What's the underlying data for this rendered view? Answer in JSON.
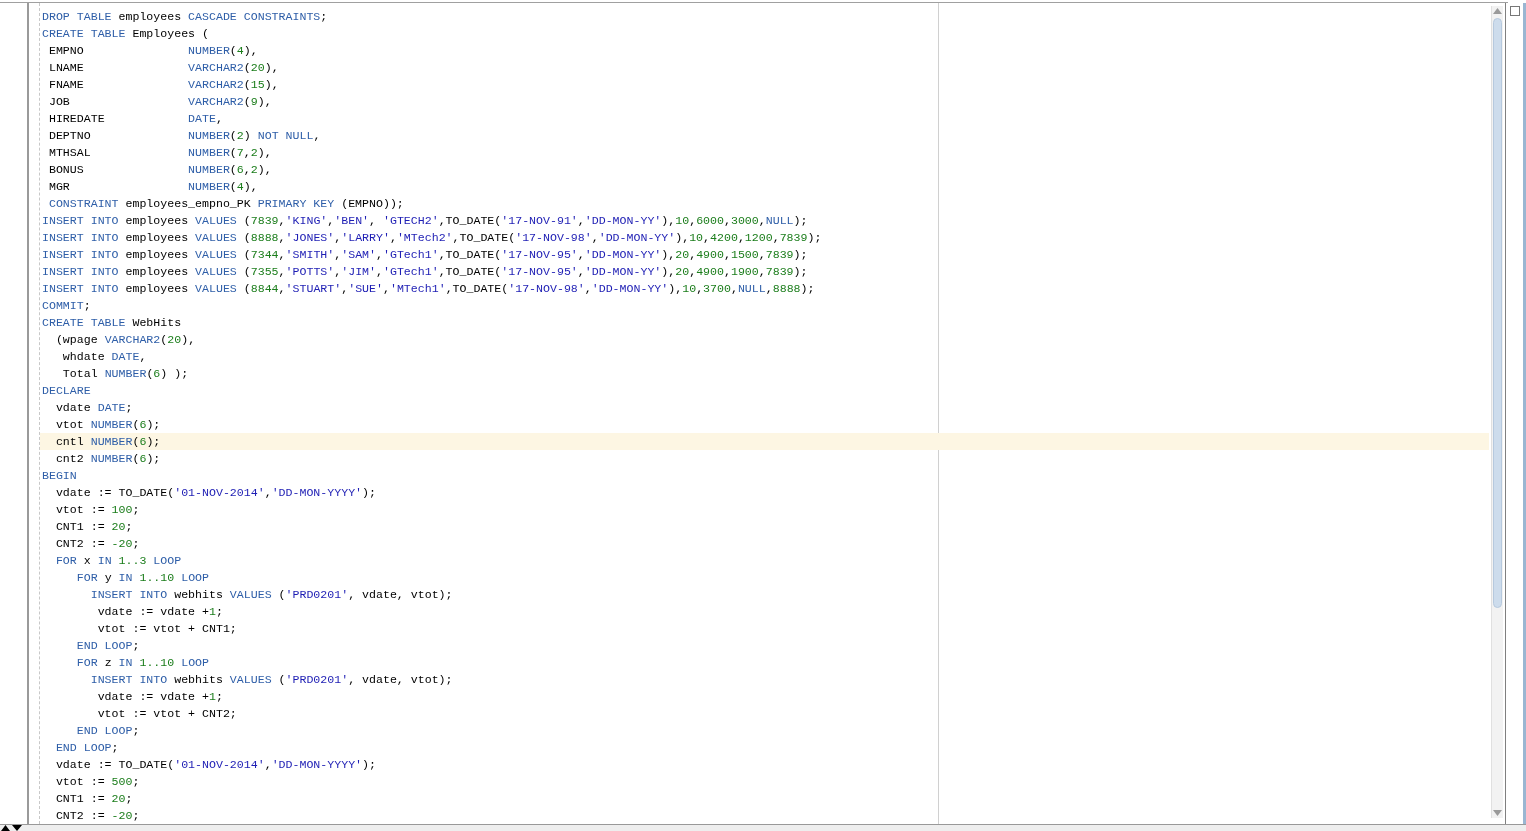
{
  "editor": {
    "lines": [
      {
        "current": false,
        "tokens": [
          {
            "kind": "kw",
            "text": "DROP TABLE"
          },
          {
            "kind": "plain",
            "text": " employees "
          },
          {
            "kind": "kw",
            "text": "CASCADE CONSTRAINTS"
          },
          {
            "kind": "plain",
            "text": ";"
          }
        ]
      },
      {
        "current": false,
        "tokens": [
          {
            "kind": "kw",
            "text": "CREATE TABLE"
          },
          {
            "kind": "plain",
            "text": " Employees ("
          }
        ]
      },
      {
        "current": false,
        "tokens": [
          {
            "kind": "plain",
            "text": " EMPNO               "
          },
          {
            "kind": "kw",
            "text": "NUMBER"
          },
          {
            "kind": "plain",
            "text": "("
          },
          {
            "kind": "num",
            "text": "4"
          },
          {
            "kind": "plain",
            "text": "),"
          }
        ]
      },
      {
        "current": false,
        "tokens": [
          {
            "kind": "plain",
            "text": " LNAME               "
          },
          {
            "kind": "kw",
            "text": "VARCHAR2"
          },
          {
            "kind": "plain",
            "text": "("
          },
          {
            "kind": "num",
            "text": "20"
          },
          {
            "kind": "plain",
            "text": "),"
          }
        ]
      },
      {
        "current": false,
        "tokens": [
          {
            "kind": "plain",
            "text": " FNAME               "
          },
          {
            "kind": "kw",
            "text": "VARCHAR2"
          },
          {
            "kind": "plain",
            "text": "("
          },
          {
            "kind": "num",
            "text": "15"
          },
          {
            "kind": "plain",
            "text": "),"
          }
        ]
      },
      {
        "current": false,
        "tokens": [
          {
            "kind": "plain",
            "text": " JOB                 "
          },
          {
            "kind": "kw",
            "text": "VARCHAR2"
          },
          {
            "kind": "plain",
            "text": "("
          },
          {
            "kind": "num",
            "text": "9"
          },
          {
            "kind": "plain",
            "text": "),"
          }
        ]
      },
      {
        "current": false,
        "tokens": [
          {
            "kind": "plain",
            "text": " HIREDATE            "
          },
          {
            "kind": "kw",
            "text": "DATE"
          },
          {
            "kind": "plain",
            "text": ","
          }
        ]
      },
      {
        "current": false,
        "tokens": [
          {
            "kind": "plain",
            "text": " DEPTNO              "
          },
          {
            "kind": "kw",
            "text": "NUMBER"
          },
          {
            "kind": "plain",
            "text": "("
          },
          {
            "kind": "num",
            "text": "2"
          },
          {
            "kind": "plain",
            "text": ") "
          },
          {
            "kind": "kw",
            "text": "NOT NULL"
          },
          {
            "kind": "plain",
            "text": ","
          }
        ]
      },
      {
        "current": false,
        "tokens": [
          {
            "kind": "plain",
            "text": " MTHSAL              "
          },
          {
            "kind": "kw",
            "text": "NUMBER"
          },
          {
            "kind": "plain",
            "text": "("
          },
          {
            "kind": "num",
            "text": "7"
          },
          {
            "kind": "plain",
            "text": ","
          },
          {
            "kind": "num",
            "text": "2"
          },
          {
            "kind": "plain",
            "text": "),"
          }
        ]
      },
      {
        "current": false,
        "tokens": [
          {
            "kind": "plain",
            "text": " BONUS               "
          },
          {
            "kind": "kw",
            "text": "NUMBER"
          },
          {
            "kind": "plain",
            "text": "("
          },
          {
            "kind": "num",
            "text": "6"
          },
          {
            "kind": "plain",
            "text": ","
          },
          {
            "kind": "num",
            "text": "2"
          },
          {
            "kind": "plain",
            "text": "),"
          }
        ]
      },
      {
        "current": false,
        "tokens": [
          {
            "kind": "plain",
            "text": " MGR                 "
          },
          {
            "kind": "kw",
            "text": "NUMBER"
          },
          {
            "kind": "plain",
            "text": "("
          },
          {
            "kind": "num",
            "text": "4"
          },
          {
            "kind": "plain",
            "text": "),"
          }
        ]
      },
      {
        "current": false,
        "tokens": [
          {
            "kind": "kw",
            "text": " CONSTRAINT"
          },
          {
            "kind": "plain",
            "text": " employees_empno_PK "
          },
          {
            "kind": "kw",
            "text": "PRIMARY KEY"
          },
          {
            "kind": "plain",
            "text": " (EMPNO));"
          }
        ]
      },
      {
        "current": false,
        "tokens": [
          {
            "kind": "kw",
            "text": "INSERT INTO"
          },
          {
            "kind": "plain",
            "text": " employees "
          },
          {
            "kind": "kw",
            "text": "VALUES"
          },
          {
            "kind": "plain",
            "text": " ("
          },
          {
            "kind": "num",
            "text": "7839"
          },
          {
            "kind": "plain",
            "text": ","
          },
          {
            "kind": "str",
            "text": "'KING'"
          },
          {
            "kind": "plain",
            "text": ","
          },
          {
            "kind": "str",
            "text": "'BEN'"
          },
          {
            "kind": "plain",
            "text": ", "
          },
          {
            "kind": "str",
            "text": "'GTECH2'"
          },
          {
            "kind": "plain",
            "text": ",TO_DATE("
          },
          {
            "kind": "str",
            "text": "'17-NOV-91'"
          },
          {
            "kind": "plain",
            "text": ","
          },
          {
            "kind": "str",
            "text": "'DD-MON-YY'"
          },
          {
            "kind": "plain",
            "text": "),"
          },
          {
            "kind": "num",
            "text": "10"
          },
          {
            "kind": "plain",
            "text": ","
          },
          {
            "kind": "num",
            "text": "6000"
          },
          {
            "kind": "plain",
            "text": ","
          },
          {
            "kind": "num",
            "text": "3000"
          },
          {
            "kind": "plain",
            "text": ","
          },
          {
            "kind": "kw",
            "text": "NULL"
          },
          {
            "kind": "plain",
            "text": ");"
          }
        ]
      },
      {
        "current": false,
        "tokens": [
          {
            "kind": "kw",
            "text": "INSERT INTO"
          },
          {
            "kind": "plain",
            "text": " employees "
          },
          {
            "kind": "kw",
            "text": "VALUES"
          },
          {
            "kind": "plain",
            "text": " ("
          },
          {
            "kind": "num",
            "text": "8888"
          },
          {
            "kind": "plain",
            "text": ","
          },
          {
            "kind": "str",
            "text": "'JONES'"
          },
          {
            "kind": "plain",
            "text": ","
          },
          {
            "kind": "str",
            "text": "'LARRY'"
          },
          {
            "kind": "plain",
            "text": ","
          },
          {
            "kind": "str",
            "text": "'MTech2'"
          },
          {
            "kind": "plain",
            "text": ",TO_DATE("
          },
          {
            "kind": "str",
            "text": "'17-NOV-98'"
          },
          {
            "kind": "plain",
            "text": ","
          },
          {
            "kind": "str",
            "text": "'DD-MON-YY'"
          },
          {
            "kind": "plain",
            "text": "),"
          },
          {
            "kind": "num",
            "text": "10"
          },
          {
            "kind": "plain",
            "text": ","
          },
          {
            "kind": "num",
            "text": "4200"
          },
          {
            "kind": "plain",
            "text": ","
          },
          {
            "kind": "num",
            "text": "1200"
          },
          {
            "kind": "plain",
            "text": ","
          },
          {
            "kind": "num",
            "text": "7839"
          },
          {
            "kind": "plain",
            "text": ");"
          }
        ]
      },
      {
        "current": false,
        "tokens": [
          {
            "kind": "kw",
            "text": "INSERT INTO"
          },
          {
            "kind": "plain",
            "text": " employees "
          },
          {
            "kind": "kw",
            "text": "VALUES"
          },
          {
            "kind": "plain",
            "text": " ("
          },
          {
            "kind": "num",
            "text": "7344"
          },
          {
            "kind": "plain",
            "text": ","
          },
          {
            "kind": "str",
            "text": "'SMITH'"
          },
          {
            "kind": "plain",
            "text": ","
          },
          {
            "kind": "str",
            "text": "'SAM'"
          },
          {
            "kind": "plain",
            "text": ","
          },
          {
            "kind": "str",
            "text": "'GTech1'"
          },
          {
            "kind": "plain",
            "text": ",TO_DATE("
          },
          {
            "kind": "str",
            "text": "'17-NOV-95'"
          },
          {
            "kind": "plain",
            "text": ","
          },
          {
            "kind": "str",
            "text": "'DD-MON-YY'"
          },
          {
            "kind": "plain",
            "text": "),"
          },
          {
            "kind": "num",
            "text": "20"
          },
          {
            "kind": "plain",
            "text": ","
          },
          {
            "kind": "num",
            "text": "4900"
          },
          {
            "kind": "plain",
            "text": ","
          },
          {
            "kind": "num",
            "text": "1500"
          },
          {
            "kind": "plain",
            "text": ","
          },
          {
            "kind": "num",
            "text": "7839"
          },
          {
            "kind": "plain",
            "text": ");"
          }
        ]
      },
      {
        "current": false,
        "tokens": [
          {
            "kind": "kw",
            "text": "INSERT INTO"
          },
          {
            "kind": "plain",
            "text": " employees "
          },
          {
            "kind": "kw",
            "text": "VALUES"
          },
          {
            "kind": "plain",
            "text": " ("
          },
          {
            "kind": "num",
            "text": "7355"
          },
          {
            "kind": "plain",
            "text": ","
          },
          {
            "kind": "str",
            "text": "'POTTS'"
          },
          {
            "kind": "plain",
            "text": ","
          },
          {
            "kind": "str",
            "text": "'JIM'"
          },
          {
            "kind": "plain",
            "text": ","
          },
          {
            "kind": "str",
            "text": "'GTech1'"
          },
          {
            "kind": "plain",
            "text": ",TO_DATE("
          },
          {
            "kind": "str",
            "text": "'17-NOV-95'"
          },
          {
            "kind": "plain",
            "text": ","
          },
          {
            "kind": "str",
            "text": "'DD-MON-YY'"
          },
          {
            "kind": "plain",
            "text": "),"
          },
          {
            "kind": "num",
            "text": "20"
          },
          {
            "kind": "plain",
            "text": ","
          },
          {
            "kind": "num",
            "text": "4900"
          },
          {
            "kind": "plain",
            "text": ","
          },
          {
            "kind": "num",
            "text": "1900"
          },
          {
            "kind": "plain",
            "text": ","
          },
          {
            "kind": "num",
            "text": "7839"
          },
          {
            "kind": "plain",
            "text": ");"
          }
        ]
      },
      {
        "current": false,
        "tokens": [
          {
            "kind": "kw",
            "text": "INSERT INTO"
          },
          {
            "kind": "plain",
            "text": " employees "
          },
          {
            "kind": "kw",
            "text": "VALUES"
          },
          {
            "kind": "plain",
            "text": " ("
          },
          {
            "kind": "num",
            "text": "8844"
          },
          {
            "kind": "plain",
            "text": ","
          },
          {
            "kind": "str",
            "text": "'STUART'"
          },
          {
            "kind": "plain",
            "text": ","
          },
          {
            "kind": "str",
            "text": "'SUE'"
          },
          {
            "kind": "plain",
            "text": ","
          },
          {
            "kind": "str",
            "text": "'MTech1'"
          },
          {
            "kind": "plain",
            "text": ",TO_DATE("
          },
          {
            "kind": "str",
            "text": "'17-NOV-98'"
          },
          {
            "kind": "plain",
            "text": ","
          },
          {
            "kind": "str",
            "text": "'DD-MON-YY'"
          },
          {
            "kind": "plain",
            "text": "),"
          },
          {
            "kind": "num",
            "text": "10"
          },
          {
            "kind": "plain",
            "text": ","
          },
          {
            "kind": "num",
            "text": "3700"
          },
          {
            "kind": "plain",
            "text": ","
          },
          {
            "kind": "kw",
            "text": "NULL"
          },
          {
            "kind": "plain",
            "text": ","
          },
          {
            "kind": "num",
            "text": "8888"
          },
          {
            "kind": "plain",
            "text": ");"
          }
        ]
      },
      {
        "current": false,
        "tokens": [
          {
            "kind": "kw",
            "text": "COMMIT"
          },
          {
            "kind": "plain",
            "text": ";"
          }
        ]
      },
      {
        "current": false,
        "tokens": [
          {
            "kind": "kw",
            "text": "CREATE TABLE"
          },
          {
            "kind": "plain",
            "text": " WebHits"
          }
        ]
      },
      {
        "current": false,
        "tokens": [
          {
            "kind": "plain",
            "text": "  (wpage "
          },
          {
            "kind": "kw",
            "text": "VARCHAR2"
          },
          {
            "kind": "plain",
            "text": "("
          },
          {
            "kind": "num",
            "text": "20"
          },
          {
            "kind": "plain",
            "text": "),"
          }
        ]
      },
      {
        "current": false,
        "tokens": [
          {
            "kind": "plain",
            "text": "   whdate "
          },
          {
            "kind": "kw",
            "text": "DATE"
          },
          {
            "kind": "plain",
            "text": ","
          }
        ]
      },
      {
        "current": false,
        "tokens": [
          {
            "kind": "plain",
            "text": "   Total "
          },
          {
            "kind": "kw",
            "text": "NUMBER"
          },
          {
            "kind": "plain",
            "text": "("
          },
          {
            "kind": "num",
            "text": "6"
          },
          {
            "kind": "plain",
            "text": ") );"
          }
        ]
      },
      {
        "current": false,
        "tokens": [
          {
            "kind": "kw",
            "text": "DECLARE"
          }
        ]
      },
      {
        "current": false,
        "tokens": [
          {
            "kind": "plain",
            "text": "  vdate "
          },
          {
            "kind": "kw",
            "text": "DATE"
          },
          {
            "kind": "plain",
            "text": ";"
          }
        ]
      },
      {
        "current": false,
        "tokens": [
          {
            "kind": "plain",
            "text": "  vtot "
          },
          {
            "kind": "kw",
            "text": "NUMBER"
          },
          {
            "kind": "plain",
            "text": "("
          },
          {
            "kind": "num",
            "text": "6"
          },
          {
            "kind": "plain",
            "text": ");"
          }
        ]
      },
      {
        "current": true,
        "tokens": [
          {
            "kind": "plain",
            "text": "  cntl "
          },
          {
            "kind": "kw",
            "text": "NUMBER"
          },
          {
            "kind": "plain",
            "text": "("
          },
          {
            "kind": "num",
            "text": "6"
          },
          {
            "kind": "plain",
            "text": ");"
          }
        ]
      },
      {
        "current": false,
        "tokens": [
          {
            "kind": "plain",
            "text": "  cnt2 "
          },
          {
            "kind": "kw",
            "text": "NUMBER"
          },
          {
            "kind": "plain",
            "text": "("
          },
          {
            "kind": "num",
            "text": "6"
          },
          {
            "kind": "plain",
            "text": ");"
          }
        ]
      },
      {
        "current": false,
        "tokens": [
          {
            "kind": "kw",
            "text": "BEGIN"
          }
        ]
      },
      {
        "current": false,
        "tokens": [
          {
            "kind": "plain",
            "text": "  vdate := TO_DATE("
          },
          {
            "kind": "str",
            "text": "'01-NOV-2014'"
          },
          {
            "kind": "plain",
            "text": ","
          },
          {
            "kind": "str",
            "text": "'DD-MON-YYYY'"
          },
          {
            "kind": "plain",
            "text": ");"
          }
        ]
      },
      {
        "current": false,
        "tokens": [
          {
            "kind": "plain",
            "text": "  vtot := "
          },
          {
            "kind": "num",
            "text": "100"
          },
          {
            "kind": "plain",
            "text": ";"
          }
        ]
      },
      {
        "current": false,
        "tokens": [
          {
            "kind": "plain",
            "text": "  CNT1 := "
          },
          {
            "kind": "num",
            "text": "20"
          },
          {
            "kind": "plain",
            "text": ";"
          }
        ]
      },
      {
        "current": false,
        "tokens": [
          {
            "kind": "plain",
            "text": "  CNT2 := "
          },
          {
            "kind": "num",
            "text": "-20"
          },
          {
            "kind": "plain",
            "text": ";"
          }
        ]
      },
      {
        "current": false,
        "tokens": [
          {
            "kind": "kw",
            "text": "  FOR"
          },
          {
            "kind": "plain",
            "text": " x "
          },
          {
            "kind": "kw",
            "text": "IN"
          },
          {
            "kind": "num",
            "text": " 1..3"
          },
          {
            "kind": "kw",
            "text": " LOOP"
          }
        ]
      },
      {
        "current": false,
        "tokens": [
          {
            "kind": "kw",
            "text": "     FOR"
          },
          {
            "kind": "plain",
            "text": " y "
          },
          {
            "kind": "kw",
            "text": "IN"
          },
          {
            "kind": "num",
            "text": " 1..10"
          },
          {
            "kind": "kw",
            "text": " LOOP"
          }
        ]
      },
      {
        "current": false,
        "tokens": [
          {
            "kind": "kw",
            "text": "       INSERT INTO"
          },
          {
            "kind": "plain",
            "text": " webhits "
          },
          {
            "kind": "kw",
            "text": "VALUES"
          },
          {
            "kind": "plain",
            "text": " ("
          },
          {
            "kind": "str",
            "text": "'PRD0201'"
          },
          {
            "kind": "plain",
            "text": ", vdate, vtot);"
          }
        ]
      },
      {
        "current": false,
        "tokens": [
          {
            "kind": "plain",
            "text": "        vdate := vdate +"
          },
          {
            "kind": "num",
            "text": "1"
          },
          {
            "kind": "plain",
            "text": ";"
          }
        ]
      },
      {
        "current": false,
        "tokens": [
          {
            "kind": "plain",
            "text": "        vtot := vtot + CNT1;"
          }
        ]
      },
      {
        "current": false,
        "tokens": [
          {
            "kind": "kw",
            "text": "     END LOOP"
          },
          {
            "kind": "plain",
            "text": ";"
          }
        ]
      },
      {
        "current": false,
        "tokens": [
          {
            "kind": "kw",
            "text": "     FOR"
          },
          {
            "kind": "plain",
            "text": " z "
          },
          {
            "kind": "kw",
            "text": "IN"
          },
          {
            "kind": "num",
            "text": " 1..10"
          },
          {
            "kind": "kw",
            "text": " LOOP"
          }
        ]
      },
      {
        "current": false,
        "tokens": [
          {
            "kind": "kw",
            "text": "       INSERT INTO"
          },
          {
            "kind": "plain",
            "text": " webhits "
          },
          {
            "kind": "kw",
            "text": "VALUES"
          },
          {
            "kind": "plain",
            "text": " ("
          },
          {
            "kind": "str",
            "text": "'PRD0201'"
          },
          {
            "kind": "plain",
            "text": ", vdate, vtot);"
          }
        ]
      },
      {
        "current": false,
        "tokens": [
          {
            "kind": "plain",
            "text": "        vdate := vdate +"
          },
          {
            "kind": "num",
            "text": "1"
          },
          {
            "kind": "plain",
            "text": ";"
          }
        ]
      },
      {
        "current": false,
        "tokens": [
          {
            "kind": "plain",
            "text": "        vtot := vtot + CNT2;"
          }
        ]
      },
      {
        "current": false,
        "tokens": [
          {
            "kind": "kw",
            "text": "     END LOOP"
          },
          {
            "kind": "plain",
            "text": ";"
          }
        ]
      },
      {
        "current": false,
        "tokens": [
          {
            "kind": "kw",
            "text": "  END LOOP"
          },
          {
            "kind": "plain",
            "text": ";"
          }
        ]
      },
      {
        "current": false,
        "tokens": [
          {
            "kind": "plain",
            "text": "  vdate := TO_DATE("
          },
          {
            "kind": "str",
            "text": "'01-NOV-2014'"
          },
          {
            "kind": "plain",
            "text": ","
          },
          {
            "kind": "str",
            "text": "'DD-MON-YYYY'"
          },
          {
            "kind": "plain",
            "text": ");"
          }
        ]
      },
      {
        "current": false,
        "tokens": [
          {
            "kind": "plain",
            "text": "  vtot := "
          },
          {
            "kind": "num",
            "text": "500"
          },
          {
            "kind": "plain",
            "text": ";"
          }
        ]
      },
      {
        "current": false,
        "tokens": [
          {
            "kind": "plain",
            "text": "  CNT1 := "
          },
          {
            "kind": "num",
            "text": "20"
          },
          {
            "kind": "plain",
            "text": ";"
          }
        ]
      },
      {
        "current": false,
        "tokens": [
          {
            "kind": "plain",
            "text": "  CNT2 := "
          },
          {
            "kind": "num",
            "text": "-20"
          },
          {
            "kind": "plain",
            "text": ";"
          }
        ]
      }
    ]
  }
}
